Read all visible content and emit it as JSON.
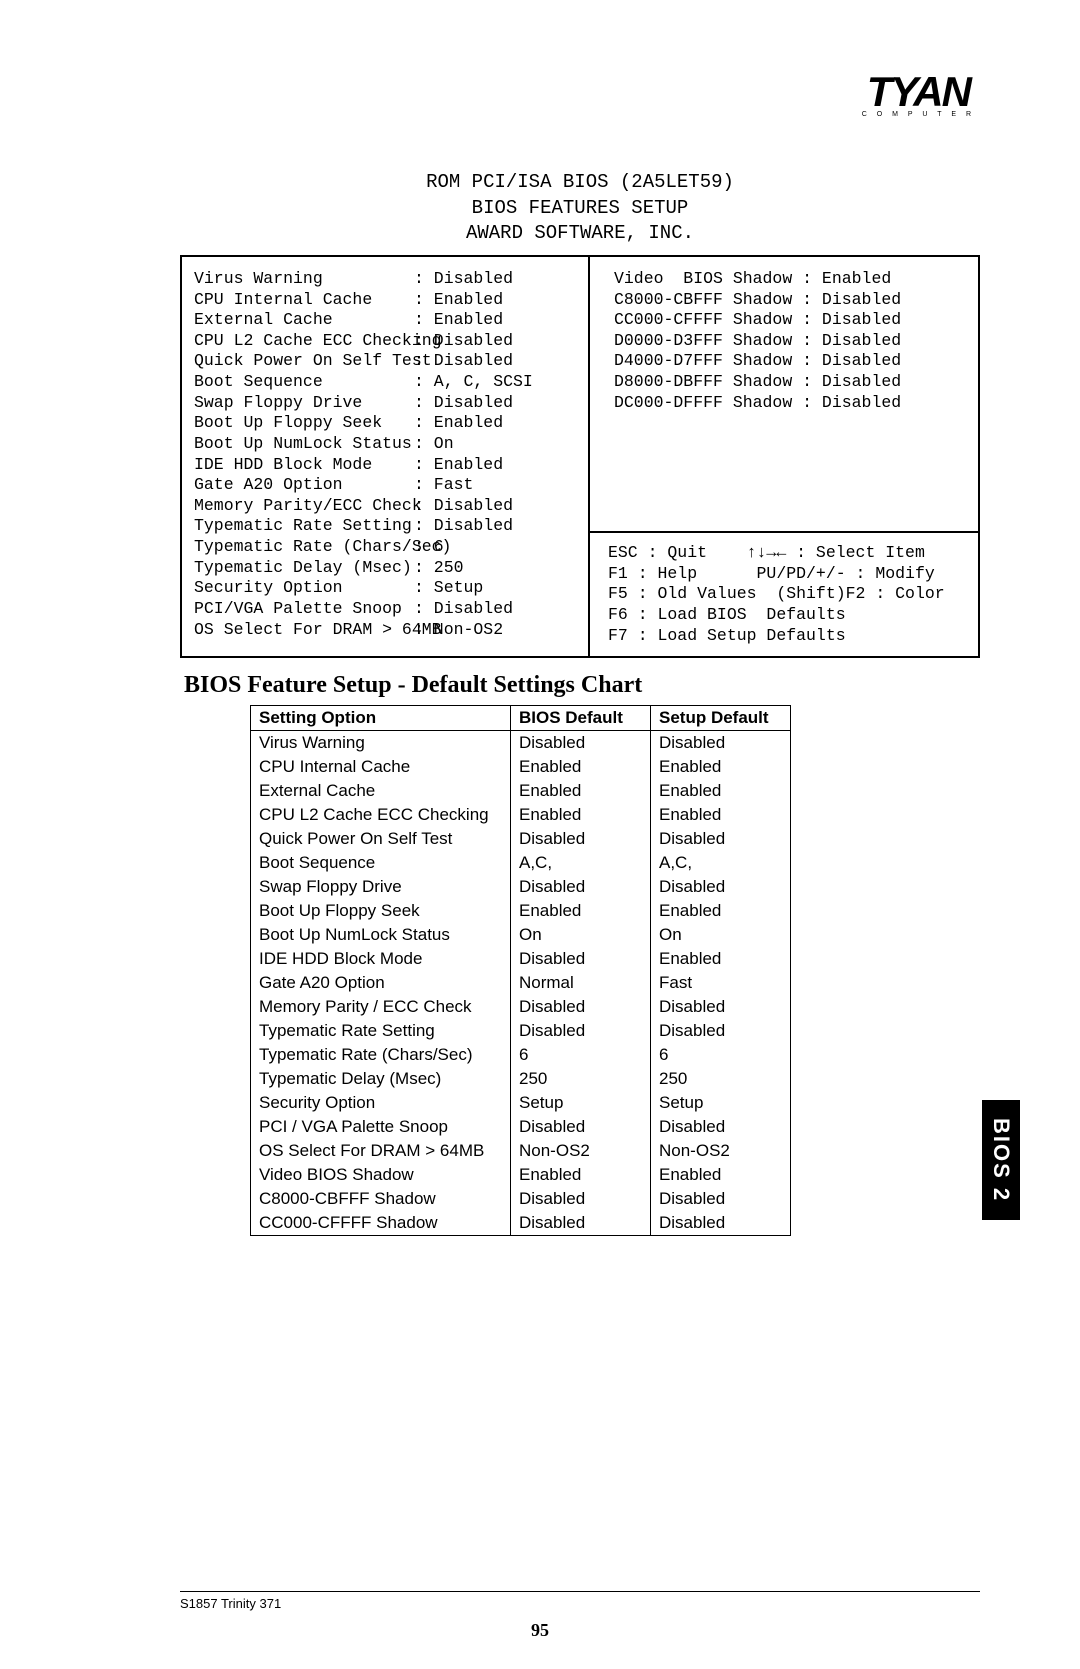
{
  "brand": {
    "name": "TYAN",
    "sub": "C O M P U T E R"
  },
  "bios_header": {
    "line1": "ROM PCI/ISA BIOS (2A5LET59)",
    "line2": "BIOS FEATURES SETUP",
    "line3": "AWARD SOFTWARE, INC."
  },
  "bios_left": [
    {
      "label": "Virus Warning",
      "value": ": Disabled"
    },
    {
      "label": "CPU Internal Cache",
      "value": ": Enabled"
    },
    {
      "label": "External Cache",
      "value": ": Enabled"
    },
    {
      "label": "CPU L2 Cache ECC Checking",
      "value": ": Disabled"
    },
    {
      "label": "Quick Power On Self Test",
      "value": ": Disabled"
    },
    {
      "label": "Boot Sequence",
      "value": ": A, C, SCSI"
    },
    {
      "label": "Swap Floppy Drive",
      "value": ": Disabled"
    },
    {
      "label": "Boot Up Floppy Seek",
      "value": ": Enabled"
    },
    {
      "label": "Boot Up NumLock Status",
      "value": ": On"
    },
    {
      "label": "IDE HDD Block Mode",
      "value": ": Enabled"
    },
    {
      "label": "Gate A20 Option",
      "value": ": Fast"
    },
    {
      "label": "Memory Parity/ECC Check",
      "value": ": Disabled"
    },
    {
      "label": "Typematic Rate Setting",
      "value": ": Disabled"
    },
    {
      "label": "Typematic Rate (Chars/Sec)",
      "value": ": 6"
    },
    {
      "label": "Typematic Delay (Msec)",
      "value": ": 250"
    },
    {
      "label": "Security Option",
      "value": ": Setup"
    },
    {
      "label": "PCI/VGA Palette Snoop",
      "value": ": Disabled"
    },
    {
      "label": "OS Select For DRAM > 64MB",
      "value": ": Non-OS2"
    }
  ],
  "bios_right": [
    "Video  BIOS Shadow : Enabled",
    "C8000-CBFFF Shadow : Disabled",
    "CC000-CFFFF Shadow : Disabled",
    "D0000-D3FFF Shadow : Disabled",
    "D4000-D7FFF Shadow : Disabled",
    "D8000-DBFFF Shadow : Disabled",
    "DC000-DFFFF Shadow : Disabled"
  ],
  "bios_help": [
    "ESC : Quit    ↑↓→← : Select Item",
    "F1 : Help      PU/PD/+/- : Modify",
    "F5 : Old Values  (Shift)F2 : Color",
    "F6 : Load BIOS  Defaults",
    "F7 : Load Setup Defaults"
  ],
  "section_title": "BIOS Feature Setup - Default Settings Chart",
  "chart_data": {
    "type": "table",
    "headers": [
      "Setting Option",
      "BIOS Default",
      "Setup Default"
    ],
    "rows": [
      [
        "Virus Warning",
        "Disabled",
        "Disabled"
      ],
      [
        "CPU Internal Cache",
        "Enabled",
        "Enabled"
      ],
      [
        "External Cache",
        "Enabled",
        "Enabled"
      ],
      [
        "CPU L2 Cache ECC Checking",
        "Enabled",
        "Enabled"
      ],
      [
        "Quick Power On Self Test",
        "Disabled",
        "Disabled"
      ],
      [
        "Boot Sequence",
        "A,C,",
        "A,C,"
      ],
      [
        "Swap Floppy Drive",
        "Disabled",
        "Disabled"
      ],
      [
        "Boot Up Floppy Seek",
        "Enabled",
        "Enabled"
      ],
      [
        "Boot Up NumLock Status",
        "On",
        "On"
      ],
      [
        "IDE HDD Block Mode",
        "Disabled",
        "Enabled"
      ],
      [
        "Gate A20 Option",
        "Normal",
        "Fast"
      ],
      [
        "Memory Parity / ECC Check",
        "Disabled",
        "Disabled"
      ],
      [
        "Typematic Rate Setting",
        "Disabled",
        "Disabled"
      ],
      [
        "Typematic Rate (Chars/Sec)",
        "6",
        "6"
      ],
      [
        "Typematic Delay (Msec)",
        "250",
        "250"
      ],
      [
        "Security Option",
        "Setup",
        "Setup"
      ],
      [
        "PCI / VGA Palette Snoop",
        "Disabled",
        "Disabled"
      ],
      [
        "OS Select For DRAM > 64MB",
        "Non-OS2",
        "Non-OS2"
      ],
      [
        "Video BIOS Shadow",
        "Enabled",
        "Enabled"
      ],
      [
        "C8000-CBFFF Shadow",
        "Disabled",
        "Disabled"
      ],
      [
        "CC000-CFFFF Shadow",
        "Disabled",
        "Disabled"
      ]
    ]
  },
  "side_tab": "BIOS 2",
  "footer": "S1857 Trinity 371",
  "page_number": "95"
}
